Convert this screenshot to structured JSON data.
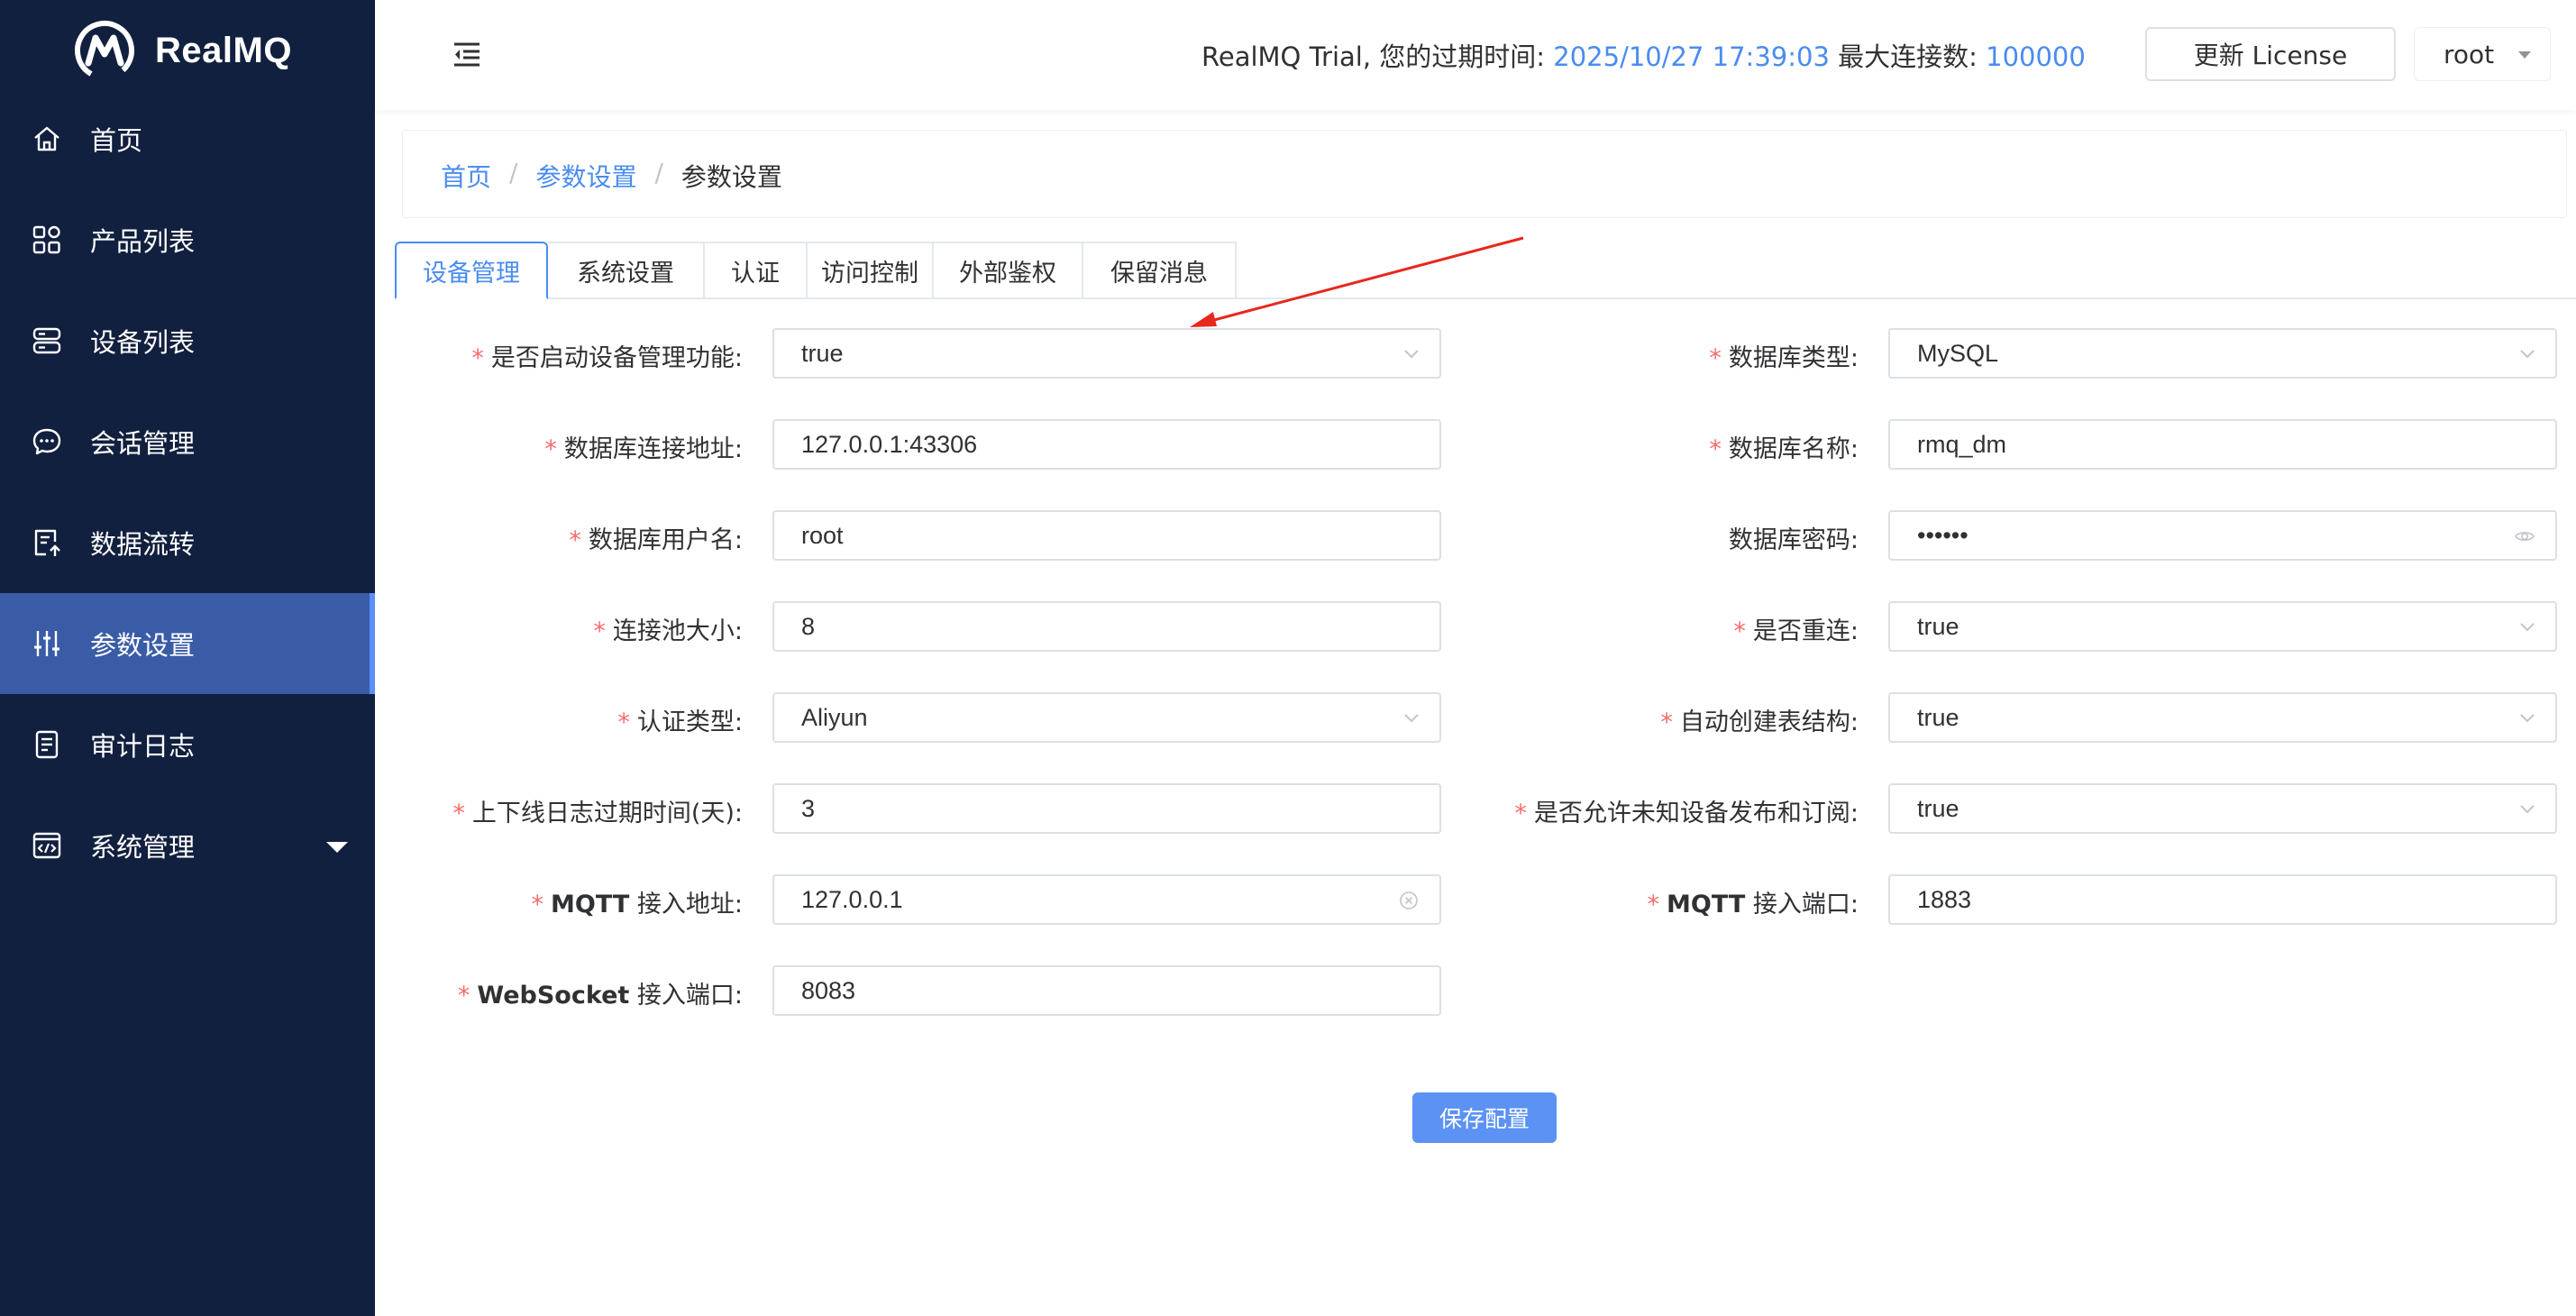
{
  "app": {
    "name": "RealMQ"
  },
  "sidebar": {
    "items": [
      {
        "label": "首页",
        "icon": "home-icon"
      },
      {
        "label": "产品列表",
        "icon": "grid-icon"
      },
      {
        "label": "设备列表",
        "icon": "server-icon"
      },
      {
        "label": "会话管理",
        "icon": "chat-icon"
      },
      {
        "label": "数据流转",
        "icon": "flow-icon"
      },
      {
        "label": "参数设置",
        "icon": "sliders-icon",
        "active": true
      },
      {
        "label": "审计日志",
        "icon": "log-icon"
      },
      {
        "label": "系统管理",
        "icon": "code-window-icon",
        "expandable": true
      }
    ]
  },
  "header": {
    "trial_text": "RealMQ Trial, 您的过期时间:",
    "expire_time": "2025/10/27 17:39:03",
    "max_conn_label": "最大连接数:",
    "max_conn_value": "100000",
    "license_button": "更新 License",
    "user": "root"
  },
  "breadcrumb": {
    "home": "首页",
    "parent": "参数设置",
    "current": "参数设置"
  },
  "tabs": [
    "设备管理",
    "系统设置",
    "认证",
    "访问控制",
    "外部鉴权",
    "保留消息"
  ],
  "active_tab": "设备管理",
  "form": {
    "enable_dm": {
      "label": "是否启动设备管理功能:",
      "value": "true"
    },
    "db_type": {
      "label": "数据库类型:",
      "value": "MySQL"
    },
    "db_url": {
      "label": "数据库连接地址:",
      "value": "127.0.0.1:43306"
    },
    "db_name": {
      "label": "数据库名称:",
      "value": "rmq_dm"
    },
    "db_user": {
      "label": "数据库用户名:",
      "value": "root"
    },
    "db_password": {
      "label": "数据库密码:",
      "value": "••••••"
    },
    "pool_size": {
      "label": "连接池大小:",
      "value": "8"
    },
    "reconnect": {
      "label": "是否重连:",
      "value": "true"
    },
    "auth_type": {
      "label": "认证类型:",
      "value": "Aliyun"
    },
    "auto_create": {
      "label": "自动创建表结构:",
      "value": "true"
    },
    "log_expire": {
      "label": "上下线日志过期时间(天):",
      "value": "3"
    },
    "allow_unknown": {
      "label": "是否允许未知设备发布和订阅:",
      "value": "true"
    },
    "mqtt_addr": {
      "label_en": "MQTT",
      "label_cn": " 接入地址:",
      "value": "127.0.0.1"
    },
    "mqtt_port": {
      "label_en": "MQTT",
      "label_cn": " 接入端口:",
      "value": "1883"
    },
    "ws_port": {
      "label_en": "WebSocket",
      "label_cn": " 接入端口:",
      "value": "8083"
    }
  },
  "save_button": "保存配置",
  "colors": {
    "sidebar_bg": "#12203f",
    "active_menu": "#3a5ca7",
    "accent": "#4a8cf0",
    "required": "#f56c6c",
    "arrow": "#e8271d"
  }
}
